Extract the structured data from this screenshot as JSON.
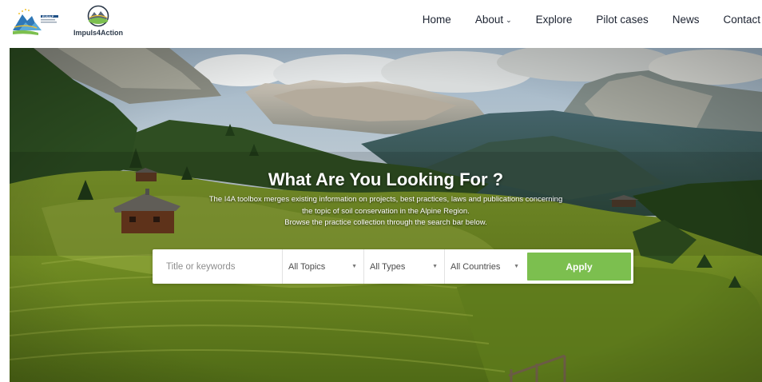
{
  "header": {
    "logo_left_text": "EUSALP",
    "logo_right_text": "Impuls4Action",
    "nav": [
      {
        "label": "Home"
      },
      {
        "label": "About",
        "has_dropdown": true
      },
      {
        "label": "Explore"
      },
      {
        "label": "Pilot cases"
      },
      {
        "label": "News"
      },
      {
        "label": "Contact"
      }
    ]
  },
  "hero": {
    "title": "What Are You Looking For ?",
    "description": [
      "The I4A toolbox merges existing information on projects, best practices, laws and publications concerning",
      "the topic of soil conservation in the Alpine Region.",
      "Browse the practice collection through the search bar below."
    ]
  },
  "search": {
    "placeholder": "Title or keywords",
    "value": "",
    "topics_selected": "All Topics",
    "types_selected": "All Types",
    "countries_selected": "All Countries",
    "apply_label": "Apply"
  },
  "colors": {
    "accent_green": "#7cbf4f",
    "nav_text": "#1c2331"
  },
  "icons": {
    "dropdown": "chevron-down-icon",
    "select_caret": "caret-down-icon"
  }
}
